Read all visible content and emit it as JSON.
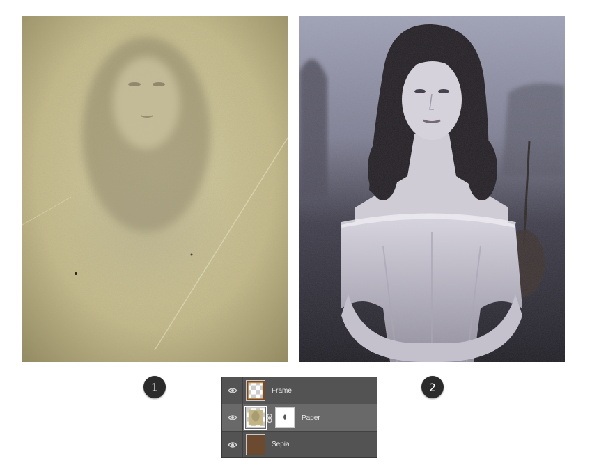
{
  "steps": [
    {
      "label": "1"
    },
    {
      "label": "2"
    }
  ],
  "layers_panel": {
    "layers": [
      {
        "name": "Frame",
        "thumbnail": "frame-thumbnail",
        "visible": true,
        "selected": false
      },
      {
        "name": "Paper",
        "thumbnail": "paper-thumbnail",
        "has_mask": true,
        "visible": true,
        "selected": true
      },
      {
        "name": "Sepia",
        "thumbnail": "sepia-thumbnail",
        "visible": true,
        "selected": false
      }
    ],
    "icons": {
      "visibility": "eye-icon",
      "mask_link": "chain-link-icon"
    }
  },
  "colors": {
    "paper": "#c9bf92",
    "photo_toning": "#9fa0b6",
    "panel_bg": "#535353",
    "selected_row": "#696969",
    "sepia": "#6b4a2f",
    "badge": "#2b2b2b"
  }
}
